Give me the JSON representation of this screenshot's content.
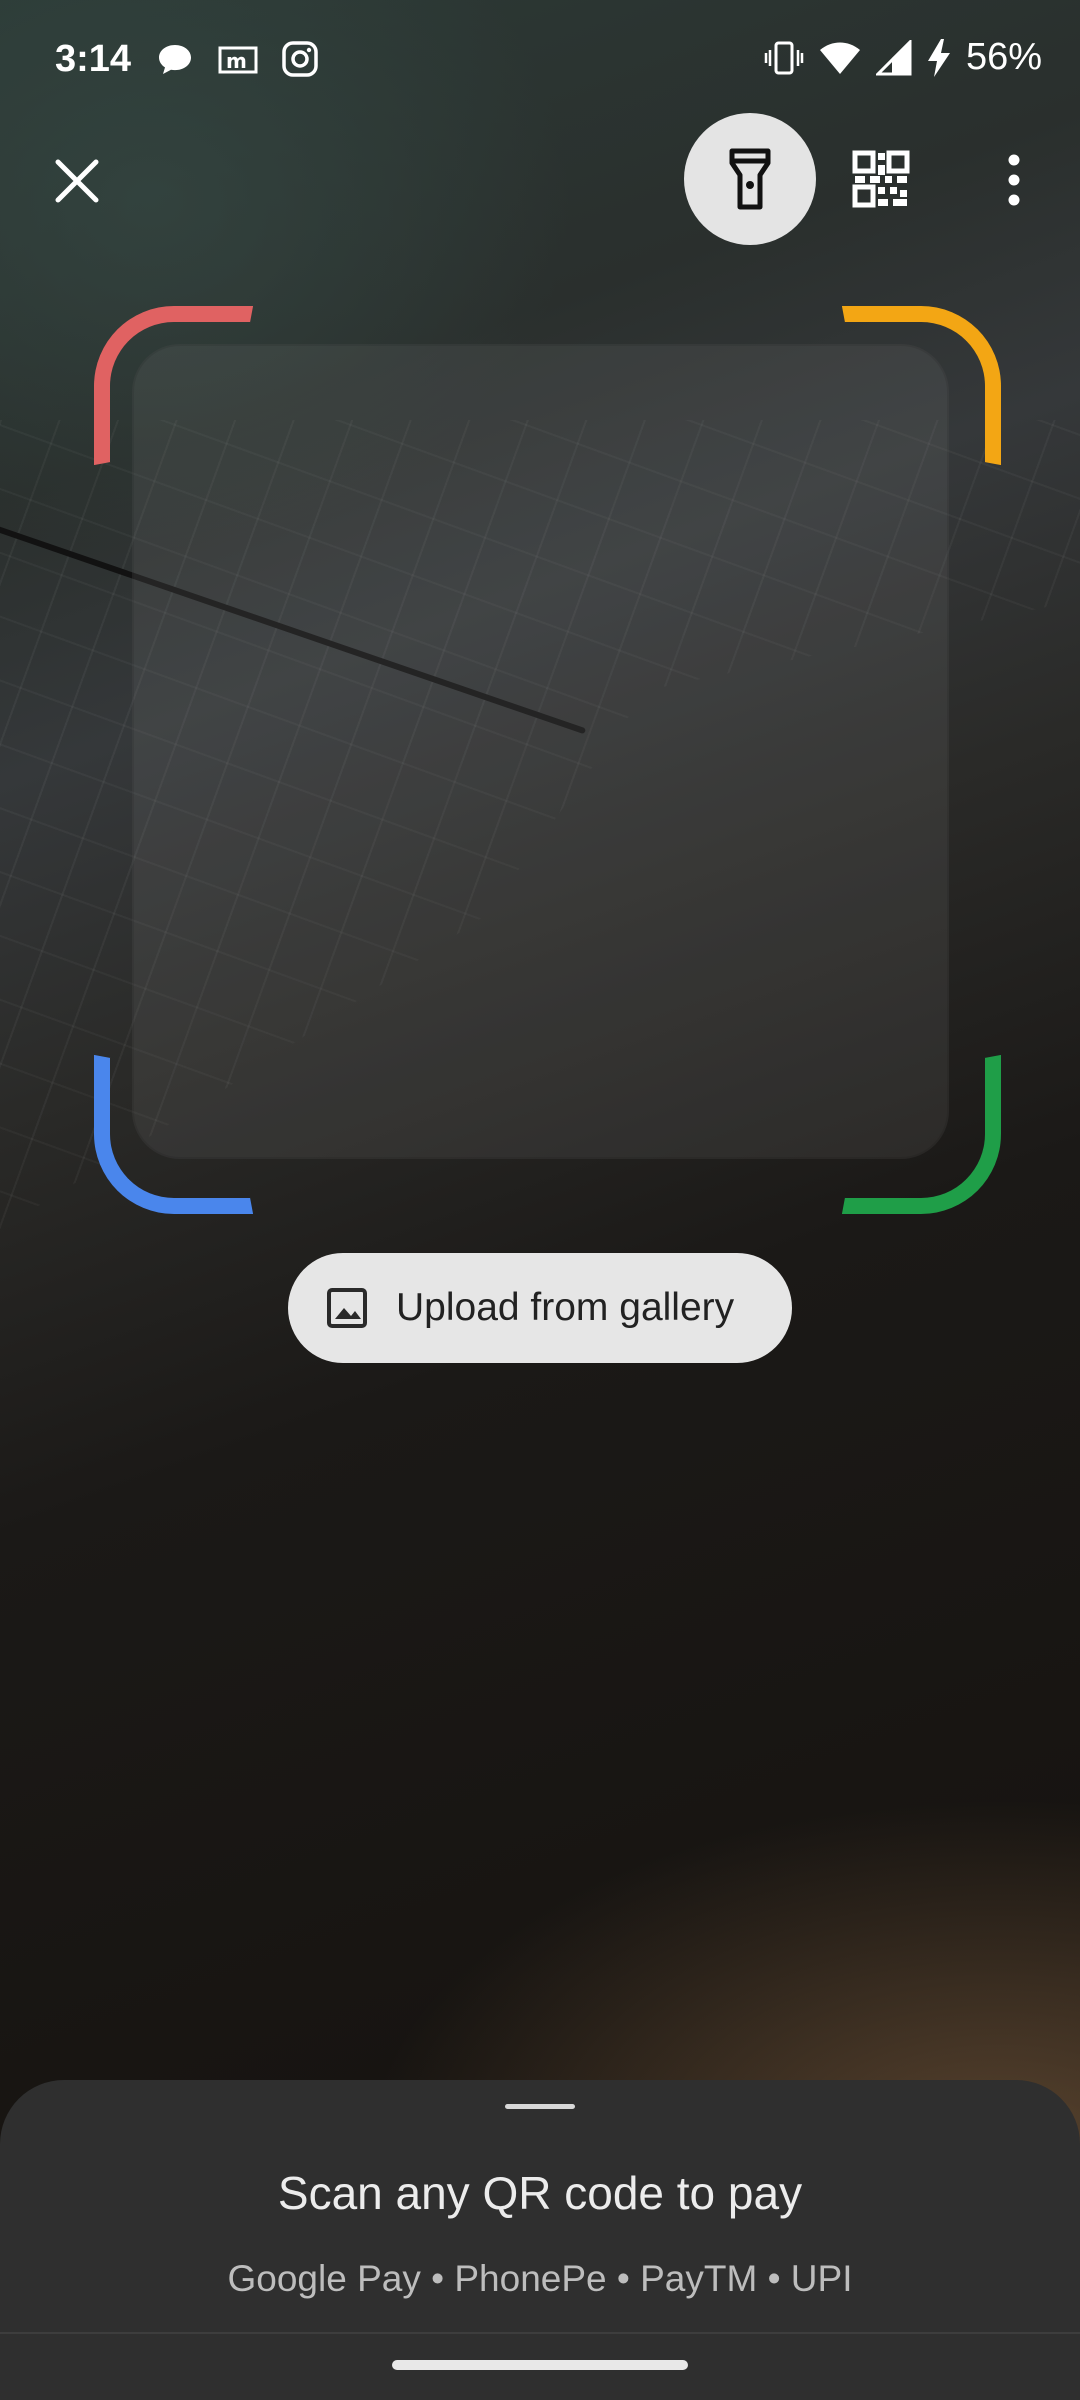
{
  "status_bar": {
    "time": "3:14",
    "battery": "56%",
    "app_icons": [
      "chat-icon",
      "myntra-icon",
      "instagram-icon"
    ],
    "system_icons": [
      "vibrate-icon",
      "wifi-icon",
      "signal-icon",
      "charging-icon"
    ]
  },
  "toolbar": {
    "close_icon": "close-icon",
    "flashlight_icon": "flashlight-icon",
    "qr_icon": "qr-code-icon",
    "more_icon": "more-vert-icon"
  },
  "scanner": {
    "corner_colors": {
      "top_left": "#e06262",
      "top_right": "#f3a614",
      "bottom_left": "#4a86ec",
      "bottom_right": "#1f9e48"
    }
  },
  "upload": {
    "label": "Upload from gallery",
    "icon": "image-icon"
  },
  "bottom_sheet": {
    "title": "Scan any QR code to pay",
    "subtitle": "Google Pay • PhonePe • PayTM • UPI"
  }
}
